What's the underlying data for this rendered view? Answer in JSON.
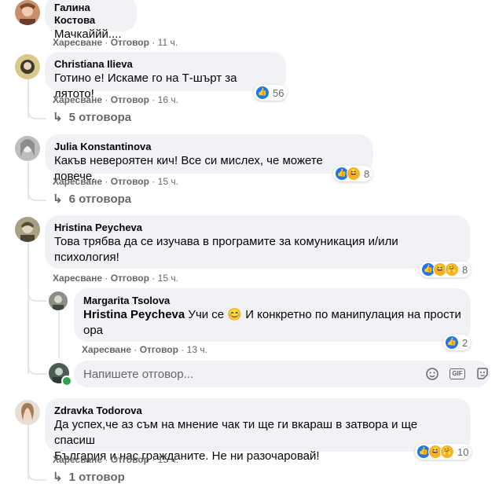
{
  "common": {
    "like": "Харесване",
    "reply": "Отговор",
    "sep": "·"
  },
  "comments": [
    {
      "name": "Галина Костова",
      "text": "Мачкаййй....",
      "time": "11 ч."
    },
    {
      "name": "Christiana Ilieva",
      "text": "Готино е! Искаме го на Т-шърт за лятото!",
      "time": "16 ч.",
      "reaction_count": "56",
      "replies": "5 отговора"
    },
    {
      "name": "Julia Konstantinova",
      "text": "Какъв невероятен кич! Все си мислех, че можете повече.",
      "time": "15 ч.",
      "reaction_count": "8",
      "replies": "6 отговора"
    },
    {
      "name": "Hristina Peycheva",
      "text_line1": "Това трябва да се изучава в програмите за комуникация и/или",
      "text_line2": "психология!",
      "time": "15 ч.",
      "reaction_count": "8"
    },
    {
      "name": "Zdravka Todorova",
      "text_line1": "Да успех,че аз съм на мнение чак ти ще ги вкараш в затвора и ще спасиш",
      "text_line2": "България и нас гражданите. Не ни разочаровай!",
      "time": "15 ч.",
      "reaction_count": "10",
      "replies": "1 отговор"
    }
  ],
  "nested_reply": {
    "name": "Margarita Tsolova",
    "mention": "Hristina Peycheva",
    "text_a": "Учи се",
    "emoji": "😊",
    "text_b": "И конкретно по манипулация на прости",
    "text_line2": "ора",
    "time": "13 ч.",
    "reaction_count": "2"
  },
  "reply_input": {
    "placeholder": "Напишете отговор..."
  },
  "colors": {
    "bubble": "#f0f2f5",
    "meta": "#65676b",
    "like_blue": "#1877f2",
    "emoji_yellow": "#f7b125",
    "thread_line": "#e4e6eb",
    "online": "#31a24c"
  },
  "icons": [
    "smile-icon",
    "camera-icon",
    "gif-icon",
    "sticker-icon"
  ]
}
